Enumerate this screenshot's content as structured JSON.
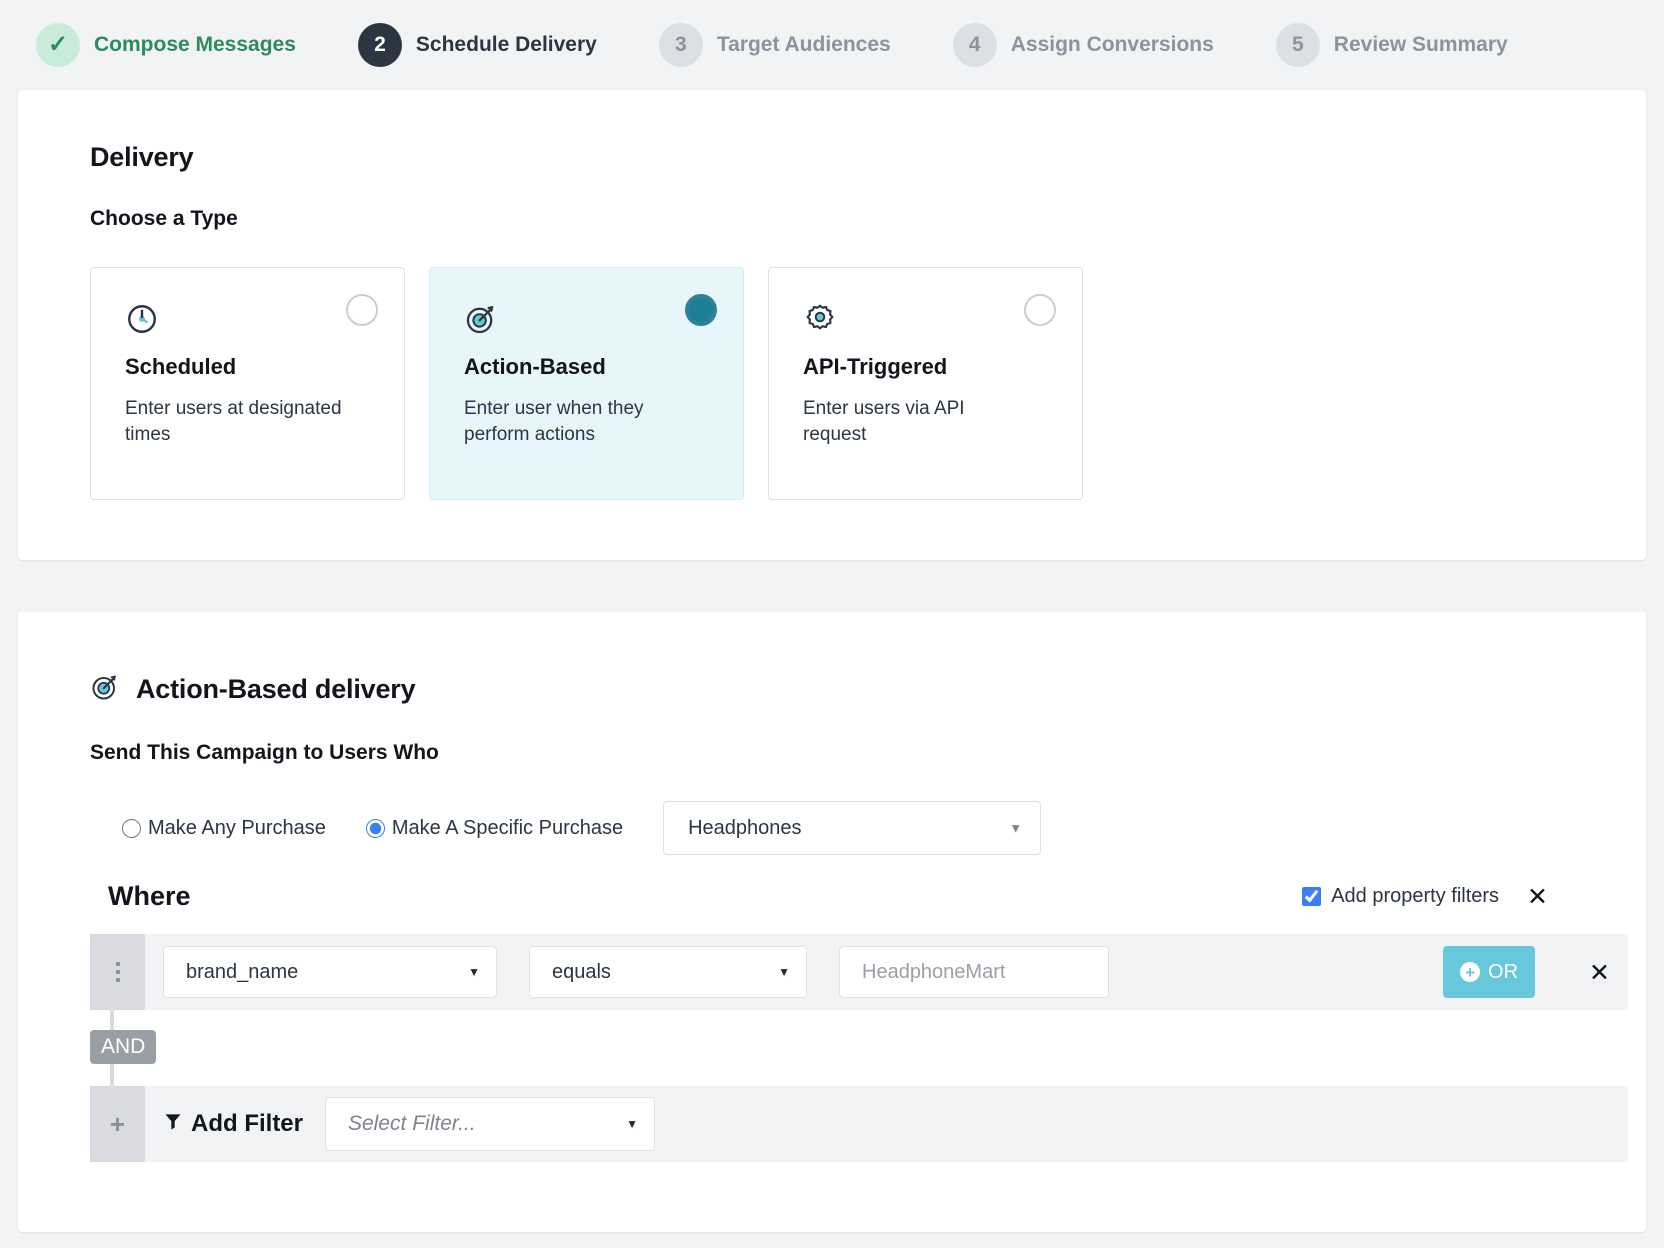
{
  "stepper": {
    "steps": [
      {
        "badge": "✓",
        "label": "Compose Messages",
        "state": "done"
      },
      {
        "badge": "2",
        "label": "Schedule Delivery",
        "state": "active"
      },
      {
        "badge": "3",
        "label": "Target Audiences",
        "state": "todo"
      },
      {
        "badge": "4",
        "label": "Assign Conversions",
        "state": "todo"
      },
      {
        "badge": "5",
        "label": "Review Summary",
        "state": "todo"
      }
    ]
  },
  "delivery": {
    "title": "Delivery",
    "subtitle": "Choose a Type",
    "types": [
      {
        "icon": "clock-icon",
        "name": "Scheduled",
        "desc": "Enter users at designated times",
        "selected": false
      },
      {
        "icon": "target-icon",
        "name": "Action-Based",
        "desc": "Enter user when they perform actions",
        "selected": true
      },
      {
        "icon": "gear-icon",
        "name": "API-Triggered",
        "desc": "Enter users via API request",
        "selected": false
      }
    ]
  },
  "action_based": {
    "header_icon": "target-icon",
    "header_title": "Action-Based delivery",
    "send_to_label": "Send This Campaign to Users Who",
    "radio_any": "Make Any Purchase",
    "radio_specific": "Make A Specific Purchase",
    "selected_radio": "specific",
    "product_select": "Headphones",
    "where_label": "Where",
    "add_property_filters_label": "Add property filters",
    "add_property_filters_checked": true,
    "close_glyph": "✕",
    "filter_row": {
      "property": "brand_name",
      "operator": "equals",
      "value_placeholder": "HeadphoneMart",
      "or_label": "OR",
      "or_plus_glyph": "+",
      "remove_glyph": "✕"
    },
    "connector": "AND",
    "add_filter": {
      "label": "Add Filter",
      "select_placeholder": "Select Filter..."
    }
  },
  "colors": {
    "accent_teal": "#67c8dc",
    "selected_card_bg": "#e6f6fb",
    "radio_blue": "#3b7ef6",
    "step_done_green": "#2e8b5f",
    "step_active_dark": "#2b3642",
    "page_bg": "#f2f3f5"
  }
}
